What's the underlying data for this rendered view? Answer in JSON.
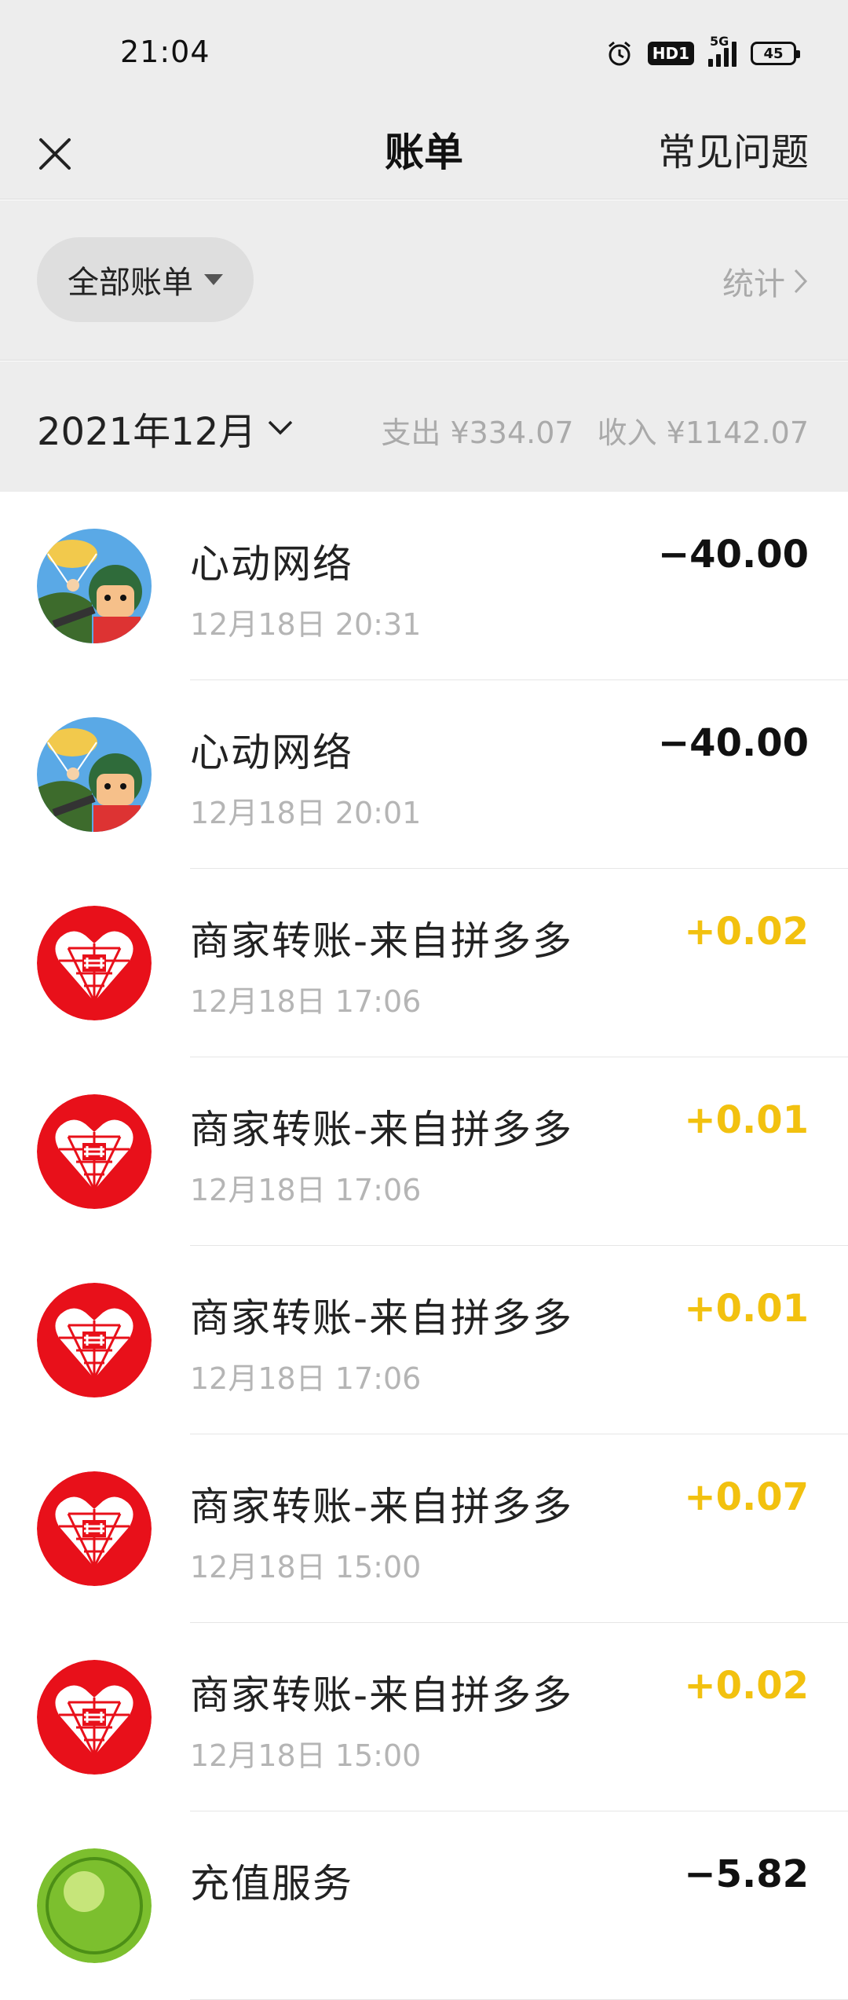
{
  "status_bar": {
    "time": "21:04",
    "hd_label": "HD1",
    "network_label": "5G",
    "battery_level": "45"
  },
  "nav": {
    "title": "账单",
    "faq_label": "常见问题"
  },
  "filter": {
    "all_bills_label": "全部账单",
    "stats_label": "统计"
  },
  "month_header": {
    "month_label": "2021年12月",
    "expense_text": "支出 ¥334.07",
    "income_text": "收入 ¥1142.07"
  },
  "colors": {
    "positive_amount": "#f2c10f",
    "negative_amount": "#111111",
    "pdd_red": "#e8101a"
  },
  "transactions": [
    {
      "avatar": "game-avatar",
      "name": "心动网络",
      "time": "12月18日  20:31",
      "amount": "−40.00",
      "type": "neg"
    },
    {
      "avatar": "game-avatar",
      "name": "心动网络",
      "time": "12月18日  20:01",
      "amount": "−40.00",
      "type": "neg"
    },
    {
      "avatar": "pdd-avatar",
      "name": "商家转账-来自拼多多",
      "time": "12月18日  17:06",
      "amount": "+0.02",
      "type": "pos"
    },
    {
      "avatar": "pdd-avatar",
      "name": "商家转账-来自拼多多",
      "time": "12月18日  17:06",
      "amount": "+0.01",
      "type": "pos"
    },
    {
      "avatar": "pdd-avatar",
      "name": "商家转账-来自拼多多",
      "time": "12月18日  17:06",
      "amount": "+0.01",
      "type": "pos"
    },
    {
      "avatar": "pdd-avatar",
      "name": "商家转账-来自拼多多",
      "time": "12月18日  15:00",
      "amount": "+0.07",
      "type": "pos"
    },
    {
      "avatar": "pdd-avatar",
      "name": "商家转账-来自拼多多",
      "time": "12月18日  15:00",
      "amount": "+0.02",
      "type": "pos"
    },
    {
      "avatar": "recharge-avatar",
      "name": "充值服务",
      "time": "",
      "amount": "−5.82",
      "type": "neg"
    }
  ]
}
